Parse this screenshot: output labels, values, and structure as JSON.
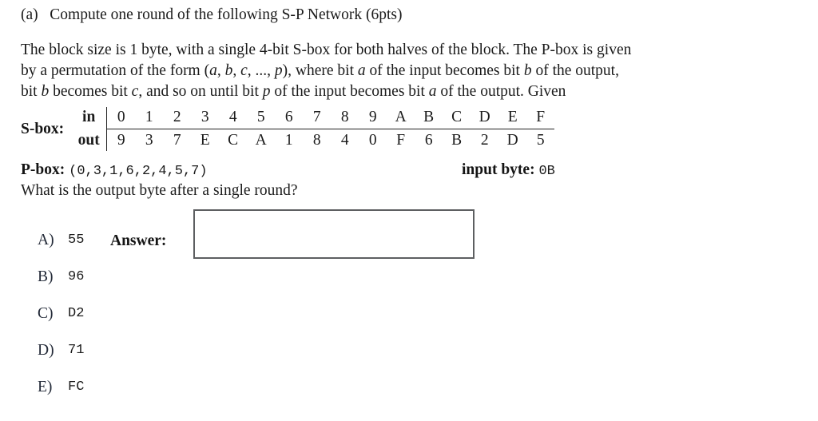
{
  "heading": {
    "marker": "(a)",
    "text": "Compute one round of the following S-P Network (6pts)"
  },
  "paragraph": {
    "line1": "The block size is 1 byte, with a single 4-bit S-box for both halves of the block. The P-box is given",
    "line2_a": "by a permutation of the form (",
    "line2_var1": "a",
    "line2_b": ", ",
    "line2_var2": "b",
    "line2_c": ", ",
    "line2_var3": "c",
    "line2_d": ", ..., ",
    "line2_var4": "p",
    "line2_e": "), where bit ",
    "line2_var5": "a",
    "line2_f": " of the input becomes bit ",
    "line2_var6": "b",
    "line2_g": " of the output,",
    "line3_a": "bit ",
    "line3_var1": "b",
    "line3_b": " becomes bit ",
    "line3_var2": "c",
    "line3_c": ", and so on until bit ",
    "line3_var3": "p",
    "line3_d": " of the input becomes bit ",
    "line3_var4": "a",
    "line3_e": " of the output. Given"
  },
  "sbox": {
    "label": "S-box:",
    "row_in_header": "in",
    "row_out_header": "out",
    "inputs": [
      "0",
      "1",
      "2",
      "3",
      "4",
      "5",
      "6",
      "7",
      "8",
      "9",
      "A",
      "B",
      "C",
      "D",
      "E",
      "F"
    ],
    "outputs": [
      "9",
      "3",
      "7",
      "E",
      "C",
      "A",
      "1",
      "8",
      "4",
      "0",
      "F",
      "6",
      "B",
      "2",
      "D",
      "5"
    ]
  },
  "pbox": {
    "label": "P-box:",
    "value": "(0,3,1,6,2,4,5,7)"
  },
  "input_byte": {
    "label": "input byte:",
    "value": "0B"
  },
  "question": "What is the output byte after a single round?",
  "answer": {
    "label": "Answer:",
    "value": "",
    "placeholder": ""
  },
  "choices": [
    {
      "key": "A)",
      "value": "55"
    },
    {
      "key": "B)",
      "value": "96"
    },
    {
      "key": "C)",
      "value": "D2"
    },
    {
      "key": "D)",
      "value": "71"
    },
    {
      "key": "E)",
      "value": "FC"
    }
  ],
  "colors": {
    "text": "#1b1b1b",
    "choice_key": "#232a38",
    "box_border": "#5d5f61",
    "rule": "#222222",
    "background": "#ffffff"
  }
}
